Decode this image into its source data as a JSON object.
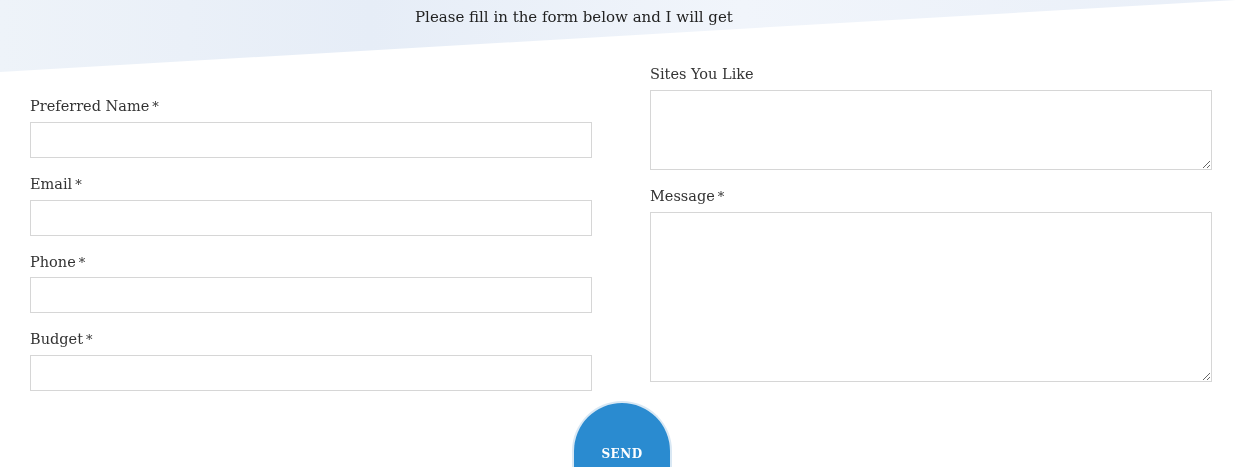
{
  "header": {
    "intro": "Please fill in the form below and I will get"
  },
  "left_fields": [
    {
      "label": "Preferred Name",
      "required": true
    },
    {
      "label": "Email",
      "required": true
    },
    {
      "label": "Phone",
      "required": true
    },
    {
      "label": "Budget",
      "required": true
    }
  ],
  "right_fields": [
    {
      "label": "Sites You Like",
      "required": false,
      "kind": "short-textarea"
    },
    {
      "label": "Message",
      "required": true,
      "kind": "tall-textarea"
    }
  ],
  "required_mark": "*",
  "submit": {
    "label": "SEND"
  }
}
